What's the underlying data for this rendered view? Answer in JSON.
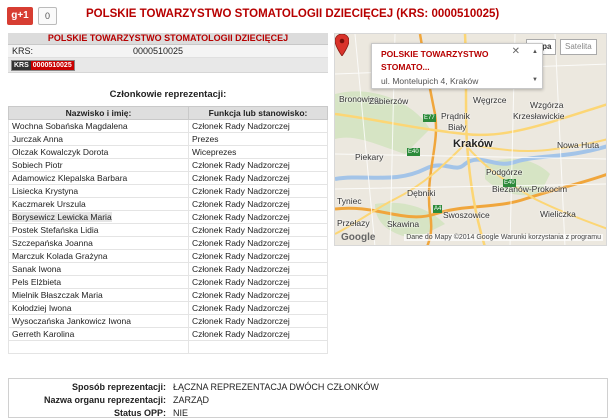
{
  "social": {
    "gplus_label": "g+1",
    "gplus_count": "0"
  },
  "page": {
    "title": "POLSKIE TOWARZYSTWO STOMATOLOGII DZIECIĘCEJ (KRS: 0000510025)"
  },
  "company": {
    "name": "POLSKIE TOWARZYSTWO STOMATOLOGII DZIECIĘCEJ",
    "krs_label": "KRS:",
    "krs_value": "0000510025",
    "krs_badge_prefix": "KRS",
    "krs_badge_number": "0000510025"
  },
  "members": {
    "title": "Członkowie reprezentacji:",
    "col_name": "Nazwisko i imię:",
    "col_role": "Funkcja lub stanowisko:",
    "rows": [
      {
        "name": "Wochna Sobańska Magdalena",
        "role": "Członek Rady Nadzorczej"
      },
      {
        "name": "Jurczak Anna",
        "role": "Prezes"
      },
      {
        "name": "Olczak Kowalczyk Dorota",
        "role": "Wiceprezes"
      },
      {
        "name": "Sobiech Piotr",
        "role": "Członek Rady Nadzorczej"
      },
      {
        "name": "Adamowicz Klepalska Barbara",
        "role": "Członek Rady Nadzorczej"
      },
      {
        "name": "Lisiecka Krystyna",
        "role": "Członek Rady Nadzorczej"
      },
      {
        "name": "Kaczmarek Urszula",
        "role": "Członek Rady Nadzorczej"
      },
      {
        "name": "Borysewicz Lewicka Maria",
        "role": "Członek Rady Nadzorczej"
      },
      {
        "name": "Postek Stefańska Lidia",
        "role": "Członek Rady Nadzorczej"
      },
      {
        "name": "Szczepańska Joanna",
        "role": "Członek Rady Nadzorczej"
      },
      {
        "name": "Marczuk Kolada Grażyna",
        "role": "Członek Rady Nadzorczej"
      },
      {
        "name": "Sanak Iwona",
        "role": "Członek Rady Nadzorczej"
      },
      {
        "name": "Pels Elżbieta",
        "role": "Członek Rady Nadzorczej"
      },
      {
        "name": "Mielnik Błaszczak Maria",
        "role": "Członek Rady Nadzorczej"
      },
      {
        "name": "Kołodziej Iwona",
        "role": "Członek Rady Nadzorczej"
      },
      {
        "name": "Wysoczańska Jankowicz Iwona",
        "role": "Członek Rady Nadzorczej"
      },
      {
        "name": "Gerreth Karolina",
        "role": "Członek Rady Nadzorczej"
      },
      {
        "name": "",
        "role": ""
      }
    ]
  },
  "map": {
    "type_map": "Mapa",
    "type_satellite": "Satelita",
    "info_title_1": "POLSKIE TOWARZYSTWO",
    "info_title_2": "STOMATO...",
    "info_address": "ul. Montelupich 4, Kraków",
    "close_symbol": "✕",
    "google_logo": "Google",
    "footer": "Dane do Mapy ©2014 Google  Warunki korzystania z programu",
    "labels": {
      "bronowice": "Bronowice",
      "zabierzow": "Zabierzów",
      "wegrzce": "Węgrzce",
      "wzgorza": "Wzgórza",
      "krzeslawickie": "Krzesławickie",
      "pradnik": "Prądnik",
      "bialy": "Biały",
      "krakow": "Kraków",
      "nowa_huta": "Nowa Huta",
      "piekary": "Piekary",
      "podgorze": "Podgórze",
      "debniki": "Dębniki",
      "bienczyce": "Bieżanów-Prokocim",
      "tyniec": "Tyniec",
      "swoszowice": "Swoszowice",
      "wieliczka": "Wieliczka",
      "skawina": "Skawina",
      "przelazy": "Przełazy"
    },
    "roads": {
      "e77": "E77",
      "e40a": "E40",
      "e40b": "E40",
      "a4": "A4"
    },
    "colors": {
      "river": "#a3c4e8",
      "park": "#c7dfb0",
      "motorway": "#f0a63c",
      "primary": "#fcd675",
      "pin": "#d9332b"
    }
  },
  "representation": {
    "way_label": "Sposób reprezentacji:",
    "way_value": "ŁĄCZNA REPREZENTACJA DWÓCH CZŁONKÓW",
    "organ_label": "Nazwa organu reprezentacji:",
    "organ_value": "ZARZĄD",
    "opp_label": "Status OPP:",
    "opp_value": "NIE"
  }
}
